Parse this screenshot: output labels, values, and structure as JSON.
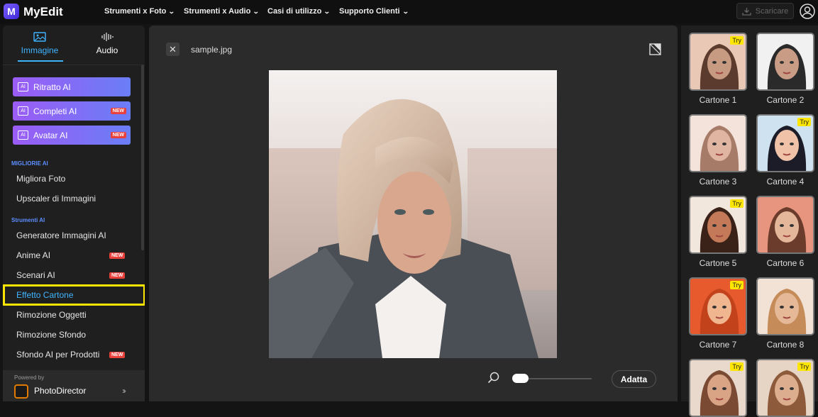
{
  "app": {
    "name": "MyEdit"
  },
  "nav": {
    "items": [
      {
        "label": "Strumenti x Foto"
      },
      {
        "label": "Strumenti x Audio"
      },
      {
        "label": "Casi di utilizzo"
      },
      {
        "label": "Supporto Clienti"
      }
    ],
    "download_label": "Scaricare"
  },
  "sidebar": {
    "tabs": [
      {
        "label": "Immagine",
        "active": true
      },
      {
        "label": "Audio",
        "active": false
      }
    ],
    "ai_buttons": [
      {
        "label": "Ritratto AI",
        "new": false
      },
      {
        "label": "Completi AI",
        "new": true
      },
      {
        "label": "Avatar AI",
        "new": true
      }
    ],
    "section_best": "MIGLIORIE AI",
    "best_items": [
      "Migliora Foto",
      "Upscaler di Immagini"
    ],
    "section_tools": "Strumenti AI",
    "tool_items": [
      {
        "label": "Generatore Immagini AI",
        "new": false
      },
      {
        "label": "Anime AI",
        "new": true
      },
      {
        "label": "Scenari AI",
        "new": true
      },
      {
        "label": "Effetto Cartone",
        "new": false,
        "active": true
      },
      {
        "label": "Rimozione Oggetti",
        "new": false
      },
      {
        "label": "Rimozione Sfondo",
        "new": false
      },
      {
        "label": "Sfondo AI per Prodotti",
        "new": true
      }
    ],
    "new_badge": "NEW",
    "powered_by": "Powered by",
    "powered_product": "PhotoDirector"
  },
  "canvas": {
    "filename": "sample.jpg",
    "fit_label": "Adatta"
  },
  "styles": {
    "try_label": "Try",
    "items": [
      {
        "label": "Cartone 1",
        "try": true
      },
      {
        "label": "Cartone 2",
        "try": false
      },
      {
        "label": "Cartone 3",
        "try": false
      },
      {
        "label": "Cartone 4",
        "try": true
      },
      {
        "label": "Cartone 5",
        "try": true
      },
      {
        "label": "Cartone 6",
        "try": false
      },
      {
        "label": "Cartone 7",
        "try": true
      },
      {
        "label": "Cartone 8",
        "try": false
      },
      {
        "label": "",
        "try": true
      },
      {
        "label": "",
        "try": true
      }
    ]
  }
}
